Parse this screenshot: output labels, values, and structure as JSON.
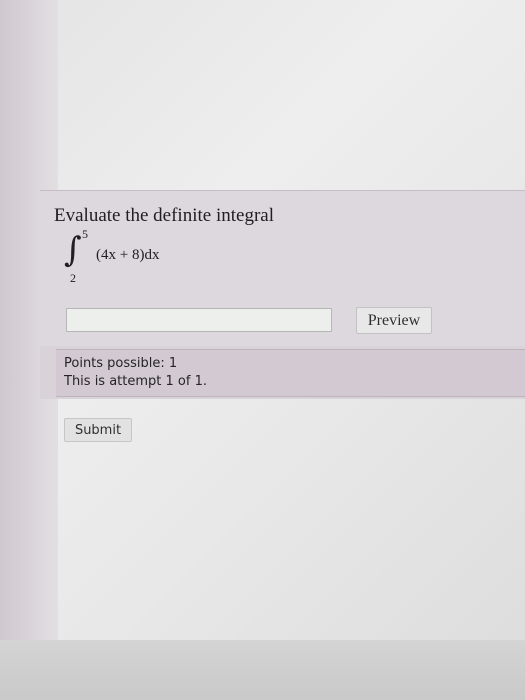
{
  "question": {
    "prompt": "Evaluate the definite integral",
    "integral_sign": "∫",
    "upper_limit": "5",
    "lower_limit": "2",
    "integrand": "(4x + 8)dx"
  },
  "answer": {
    "value": "",
    "placeholder": ""
  },
  "buttons": {
    "preview_label": "Preview",
    "submit_label": "Submit"
  },
  "info": {
    "points_line": "Points possible: 1",
    "attempt_line": "This is attempt 1 of 1."
  },
  "colors": {
    "panel": "#ddd8dd",
    "info_box": "#d2c9d2",
    "text": "#202020"
  }
}
